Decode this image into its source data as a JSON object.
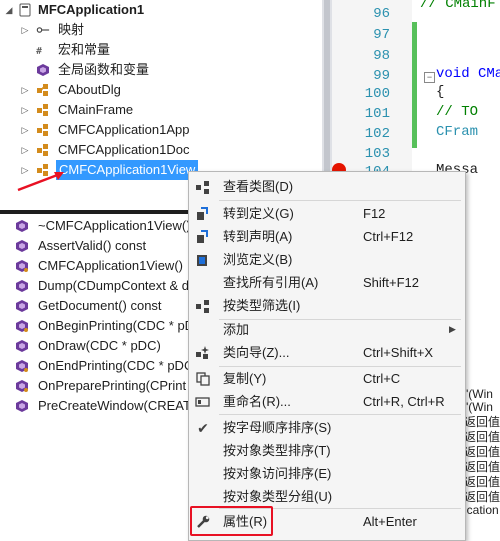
{
  "class_tree": {
    "root": "MFCApplication1",
    "items": [
      {
        "label": "映射",
        "icon": "map-icon"
      },
      {
        "label": "宏和常量",
        "icon": "macro-icon"
      },
      {
        "label": "全局函数和变量",
        "icon": "global-icon"
      },
      {
        "label": "CAboutDlg",
        "icon": "class-icon"
      },
      {
        "label": "CMainFrame",
        "icon": "class-icon"
      },
      {
        "label": "CMFCApplication1App",
        "icon": "class-icon"
      },
      {
        "label": "CMFCApplication1Doc",
        "icon": "class-icon"
      },
      {
        "label": "CMFCApplication1View",
        "icon": "class-icon",
        "selected": true
      }
    ]
  },
  "members": [
    "~CMFCApplication1View()",
    "AssertValid() const",
    "CMFCApplication1View()",
    "Dump(CDumpContext & d",
    "GetDocument() const",
    "OnBeginPrinting(CDC * pD",
    "OnDraw(CDC * pDC)",
    "OnEndPrinting(CDC * pDC",
    "OnPreparePrinting(CPrint",
    "PreCreateWindow(CREAT"
  ],
  "editor": {
    "line_numbers": [
      "96",
      "97",
      "98",
      "99",
      "100",
      "101",
      "102",
      "103",
      "104"
    ],
    "code_lines": [
      "// CMainF",
      "",
      "",
      "void CMai",
      "{",
      "    // TO",
      "    CFram",
      "",
      "    Messa"
    ]
  },
  "output_lines": [
    "\"(Win",
    "\"(Win",
    "返回值",
    "返回值",
    "返回值",
    "返回值",
    "返回值",
    "返回值",
    "ication"
  ],
  "context_menu": {
    "items": [
      {
        "label": "查看类图(D)",
        "shortcut": "",
        "icon": "class-diagram-icon"
      },
      {
        "label": "转到定义(G)",
        "shortcut": "F12",
        "icon": "go-to-definition-icon"
      },
      {
        "label": "转到声明(A)",
        "shortcut": "Ctrl+F12",
        "icon": "go-to-declaration-icon"
      },
      {
        "label": "浏览定义(B)",
        "shortcut": "",
        "icon": "browse-definition-icon"
      },
      {
        "label": "查找所有引用(A)",
        "shortcut": "Shift+F12",
        "icon": ""
      },
      {
        "label": "按类型筛选(I)",
        "shortcut": "",
        "icon": "filter-type-icon"
      },
      {
        "label": "添加",
        "shortcut": "",
        "icon": "",
        "submenu": true
      },
      {
        "label": "类向导(Z)...",
        "shortcut": "Ctrl+Shift+X",
        "icon": "class-wizard-icon"
      },
      {
        "label": "复制(Y)",
        "shortcut": "Ctrl+C",
        "icon": "copy-icon"
      },
      {
        "label": "重命名(R)...",
        "shortcut": "Ctrl+R, Ctrl+R",
        "icon": "rename-icon"
      },
      {
        "label": "按字母顺序排序(S)",
        "shortcut": "",
        "icon": "checkmark-icon"
      },
      {
        "label": "按对象类型排序(T)",
        "shortcut": "",
        "icon": ""
      },
      {
        "label": "按对象访问排序(E)",
        "shortcut": "",
        "icon": ""
      },
      {
        "label": "按对象类型分组(U)",
        "shortcut": "",
        "icon": ""
      },
      {
        "label": "属性(R)",
        "shortcut": "Alt+Enter",
        "icon": "wrench-icon"
      }
    ]
  },
  "colors": {
    "accent": "#3399ff",
    "highlight_box": "#e81123",
    "breakpoint": "#e51400",
    "line_number": "#2b91af",
    "changed_bar": "#57c05a"
  }
}
